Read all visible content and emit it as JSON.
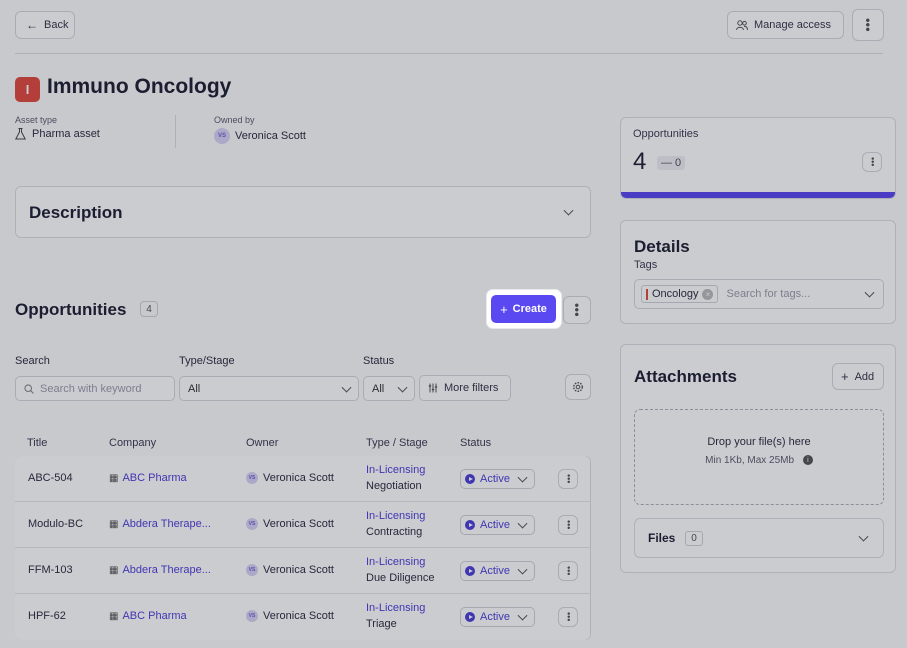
{
  "header": {
    "back_label": "Back",
    "manage_access_label": "Manage access"
  },
  "asset": {
    "initial": "I",
    "title": "Immuno Oncology",
    "asset_type_label": "Asset type",
    "asset_type_value": "Pharma asset",
    "owned_by_label": "Owned by",
    "owner_initials": "VS",
    "owner_name": "Veronica Scott"
  },
  "description": {
    "title": "Description"
  },
  "opportunities": {
    "title": "Opportunities",
    "count": "4",
    "create_label": "Create",
    "filters": {
      "search_label": "Search",
      "search_placeholder": "Search with keyword",
      "type_stage_label": "Type/Stage",
      "type_stage_value": "All",
      "status_label": "Status",
      "status_value": "All",
      "more_filters_label": "More filters"
    },
    "columns": [
      "Title",
      "Company",
      "Owner",
      "Type / Stage",
      "Status"
    ],
    "rows": [
      {
        "title": "ABC-504",
        "company": "ABC Pharma",
        "owner_initials": "VS",
        "owner": "Veronica Scott",
        "type": "In-Licensing",
        "stage": "Negotiation",
        "status": "Active"
      },
      {
        "title": "Modulo-BC",
        "company": "Abdera Therape...",
        "owner_initials": "VS",
        "owner": "Veronica Scott",
        "type": "In-Licensing",
        "stage": "Contracting",
        "status": "Active"
      },
      {
        "title": "FFM-103",
        "company": "Abdera Therape...",
        "owner_initials": "VS",
        "owner": "Veronica Scott",
        "type": "In-Licensing",
        "stage": "Due Diligence",
        "status": "Active"
      },
      {
        "title": "HPF-62",
        "company": "ABC Pharma",
        "owner_initials": "VS",
        "owner": "Veronica Scott",
        "type": "In-Licensing",
        "stage": "Triage",
        "status": "Active"
      }
    ]
  },
  "opp_summary": {
    "label": "Opportunities",
    "value": "4",
    "change": "— 0"
  },
  "details": {
    "title": "Details",
    "tags_label": "Tags",
    "tag_value": "Oncology",
    "tags_placeholder": "Search for tags..."
  },
  "attachments": {
    "title": "Attachments",
    "add_label": "Add",
    "drop_title": "Drop your file(s) here",
    "drop_hint": "Min 1Kb, Max 25Mb",
    "files_label": "Files",
    "files_count": "0"
  },
  "colors": {
    "accent": "#5a48f0",
    "asset_badge": "#e04a3f"
  }
}
